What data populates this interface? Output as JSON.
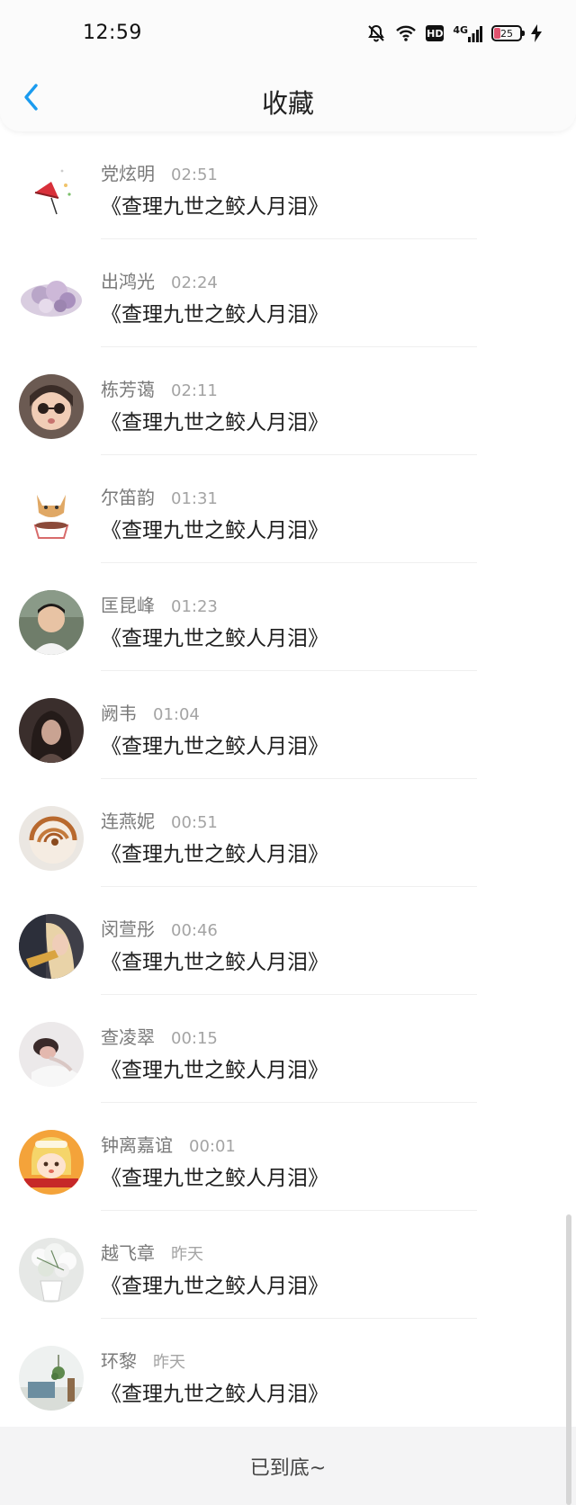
{
  "status_bar": {
    "time": "12:59",
    "network": "4G",
    "hd": "HD",
    "battery": "25",
    "icons": [
      "bell-mute-icon",
      "wifi-icon",
      "hd-icon",
      "signal-icon",
      "battery-icon",
      "charging-icon"
    ]
  },
  "header": {
    "title": "收藏",
    "back_icon": "chevron-left-icon",
    "accent_color": "#1a9bef"
  },
  "favorites": [
    {
      "name": "党炫明",
      "time": "02:51",
      "title": "《查理九世之鲛人月泪》",
      "avatar": "umbrella-illustration"
    },
    {
      "name": "出鸿光",
      "time": "02:24",
      "title": "《查理九世之鲛人月泪》",
      "avatar": "purple-flower-cloud"
    },
    {
      "name": "栋芳蔼",
      "time": "02:11",
      "title": "《查理九世之鲛人月泪》",
      "avatar": "child-sunglasses"
    },
    {
      "name": "尔笛韵",
      "time": "01:31",
      "title": "《查理九世之鲛人月泪》",
      "avatar": "cartoon-cat-teacup"
    },
    {
      "name": "匡昆峰",
      "time": "01:23",
      "title": "《查理九世之鲛人月泪》",
      "avatar": "boy-photo"
    },
    {
      "name": "阙韦",
      "time": "01:04",
      "title": "《查理九世之鲛人月泪》",
      "avatar": "girl-dark-photo"
    },
    {
      "name": "连燕妮",
      "time": "00:51",
      "title": "《查理九世之鲛人月泪》",
      "avatar": "nautilus-shell"
    },
    {
      "name": "闵萱彤",
      "time": "00:46",
      "title": "《查理九世之鲛人月泪》",
      "avatar": "blonde-girl-photo"
    },
    {
      "name": "查凌翠",
      "time": "00:15",
      "title": "《查理九世之鲛人月泪》",
      "avatar": "person-lying-photo"
    },
    {
      "name": "钟离嘉谊",
      "time": "00:01",
      "title": "《查理九世之鲛人月泪》",
      "avatar": "cartoon-girl-orange"
    },
    {
      "name": "越飞章",
      "time": "昨天",
      "title": "《查理九世之鲛人月泪》",
      "avatar": "white-flowers-vase"
    },
    {
      "name": "环黎",
      "time": "昨天",
      "title": "《查理九世之鲛人月泪》",
      "avatar": "living-room-plant"
    }
  ],
  "footer": {
    "text": "已到底~"
  }
}
